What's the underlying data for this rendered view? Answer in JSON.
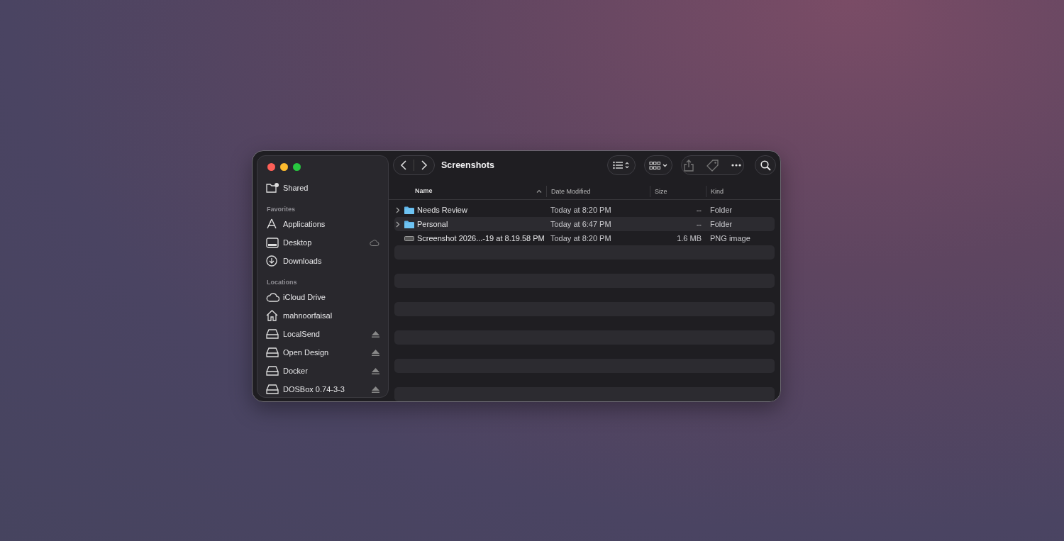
{
  "window": {
    "title": "Screenshots"
  },
  "sidebar": {
    "top_items": [
      {
        "label": "Shared",
        "kind": "shared",
        "ejectable": false,
        "cloud_synced": false
      }
    ],
    "sections": [
      {
        "title": "Favorites",
        "items": [
          {
            "label": "Applications",
            "kind": "apps",
            "ejectable": false,
            "cloud_synced": false
          },
          {
            "label": "Desktop",
            "kind": "desktop",
            "ejectable": false,
            "cloud_synced": true
          },
          {
            "label": "Downloads",
            "kind": "downloads",
            "ejectable": false,
            "cloud_synced": false
          }
        ]
      },
      {
        "title": "Locations",
        "items": [
          {
            "label": "iCloud Drive",
            "kind": "icloud",
            "ejectable": false,
            "cloud_synced": false
          },
          {
            "label": "mahnoorfaisal",
            "kind": "home",
            "ejectable": false,
            "cloud_synced": false
          },
          {
            "label": "LocalSend",
            "kind": "drive",
            "ejectable": true,
            "cloud_synced": false
          },
          {
            "label": "Open Design",
            "kind": "drive",
            "ejectable": true,
            "cloud_synced": false
          },
          {
            "label": "Docker",
            "kind": "drive",
            "ejectable": true,
            "cloud_synced": false
          },
          {
            "label": "DOSBox 0.74-3-3",
            "kind": "drive",
            "ejectable": true,
            "cloud_synced": false
          }
        ]
      }
    ]
  },
  "table": {
    "columns": [
      {
        "label": "Name",
        "sorted": true
      },
      {
        "label": "Date Modified",
        "sorted": false
      },
      {
        "label": "Size",
        "sorted": false
      },
      {
        "label": "Kind",
        "sorted": false
      }
    ],
    "rows": [
      {
        "name": "Needs Review",
        "date": "Today at 8:20 PM",
        "size": "--",
        "kind_text": "Folder",
        "kind": "folder"
      },
      {
        "name": "Personal",
        "date": "Today at 6:47 PM",
        "size": "--",
        "kind_text": "Folder",
        "kind": "folder"
      },
      {
        "name": "Screenshot 2026...-19 at 8.19.58 PM",
        "date": "Today at 8:20 PM",
        "size": "1.6 MB",
        "kind_text": "PNG image",
        "kind": "image"
      }
    ]
  }
}
